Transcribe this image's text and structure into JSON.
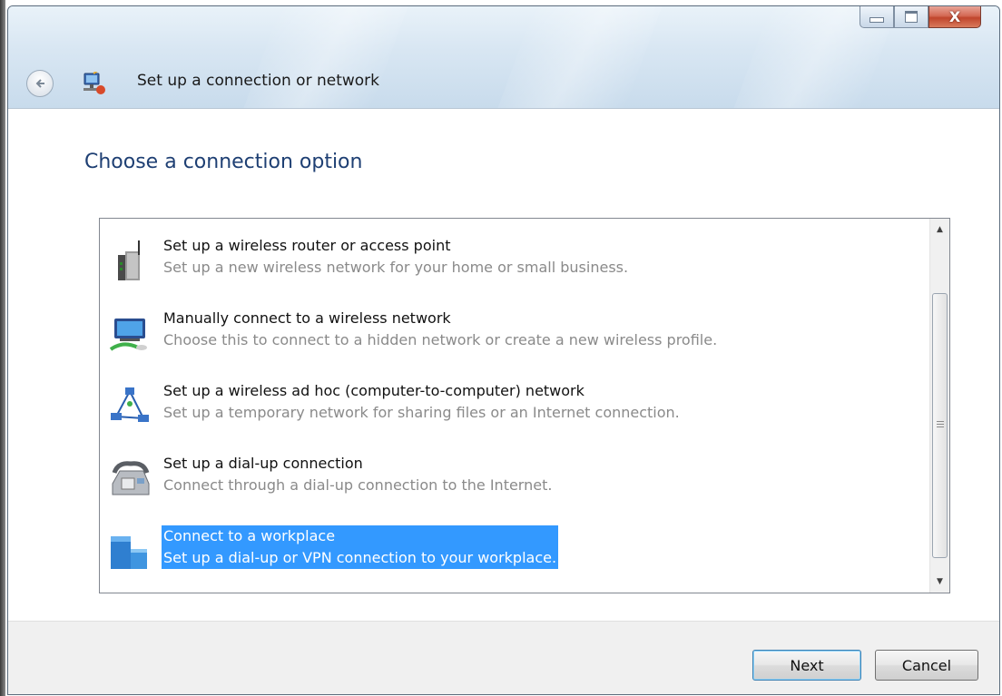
{
  "window": {
    "title": "Set up a connection or network",
    "controls": {
      "minimize_icon": "minimize-icon",
      "maximize_icon": "maximize-icon",
      "close_glyph": "X"
    }
  },
  "page": {
    "heading": "Choose a connection option"
  },
  "options": [
    {
      "title": "Set up a wireless router or access point",
      "description": "Set up a new wireless network for your home or small business.",
      "icon": "wireless-router-icon",
      "selected": false
    },
    {
      "title": "Manually connect to a wireless network",
      "description": "Choose this to connect to a hidden network or create a new wireless profile.",
      "icon": "wireless-network-icon",
      "selected": false
    },
    {
      "title": "Set up a wireless ad hoc (computer-to-computer) network",
      "description": "Set up a temporary network for sharing files or an Internet connection.",
      "icon": "ad-hoc-network-icon",
      "selected": false
    },
    {
      "title": "Set up a dial-up connection",
      "description": "Connect through a dial-up connection to the Internet.",
      "icon": "dial-up-phone-icon",
      "selected": false
    },
    {
      "title": "Connect to a workplace",
      "description": "Set up a dial-up or VPN connection to your workplace.",
      "icon": "workplace-icon",
      "selected": true
    }
  ],
  "buttons": {
    "next": "Next",
    "cancel": "Cancel"
  },
  "colors": {
    "heading": "#1e3f73",
    "selection": "#3399ff",
    "description": "#8a8a8a"
  }
}
